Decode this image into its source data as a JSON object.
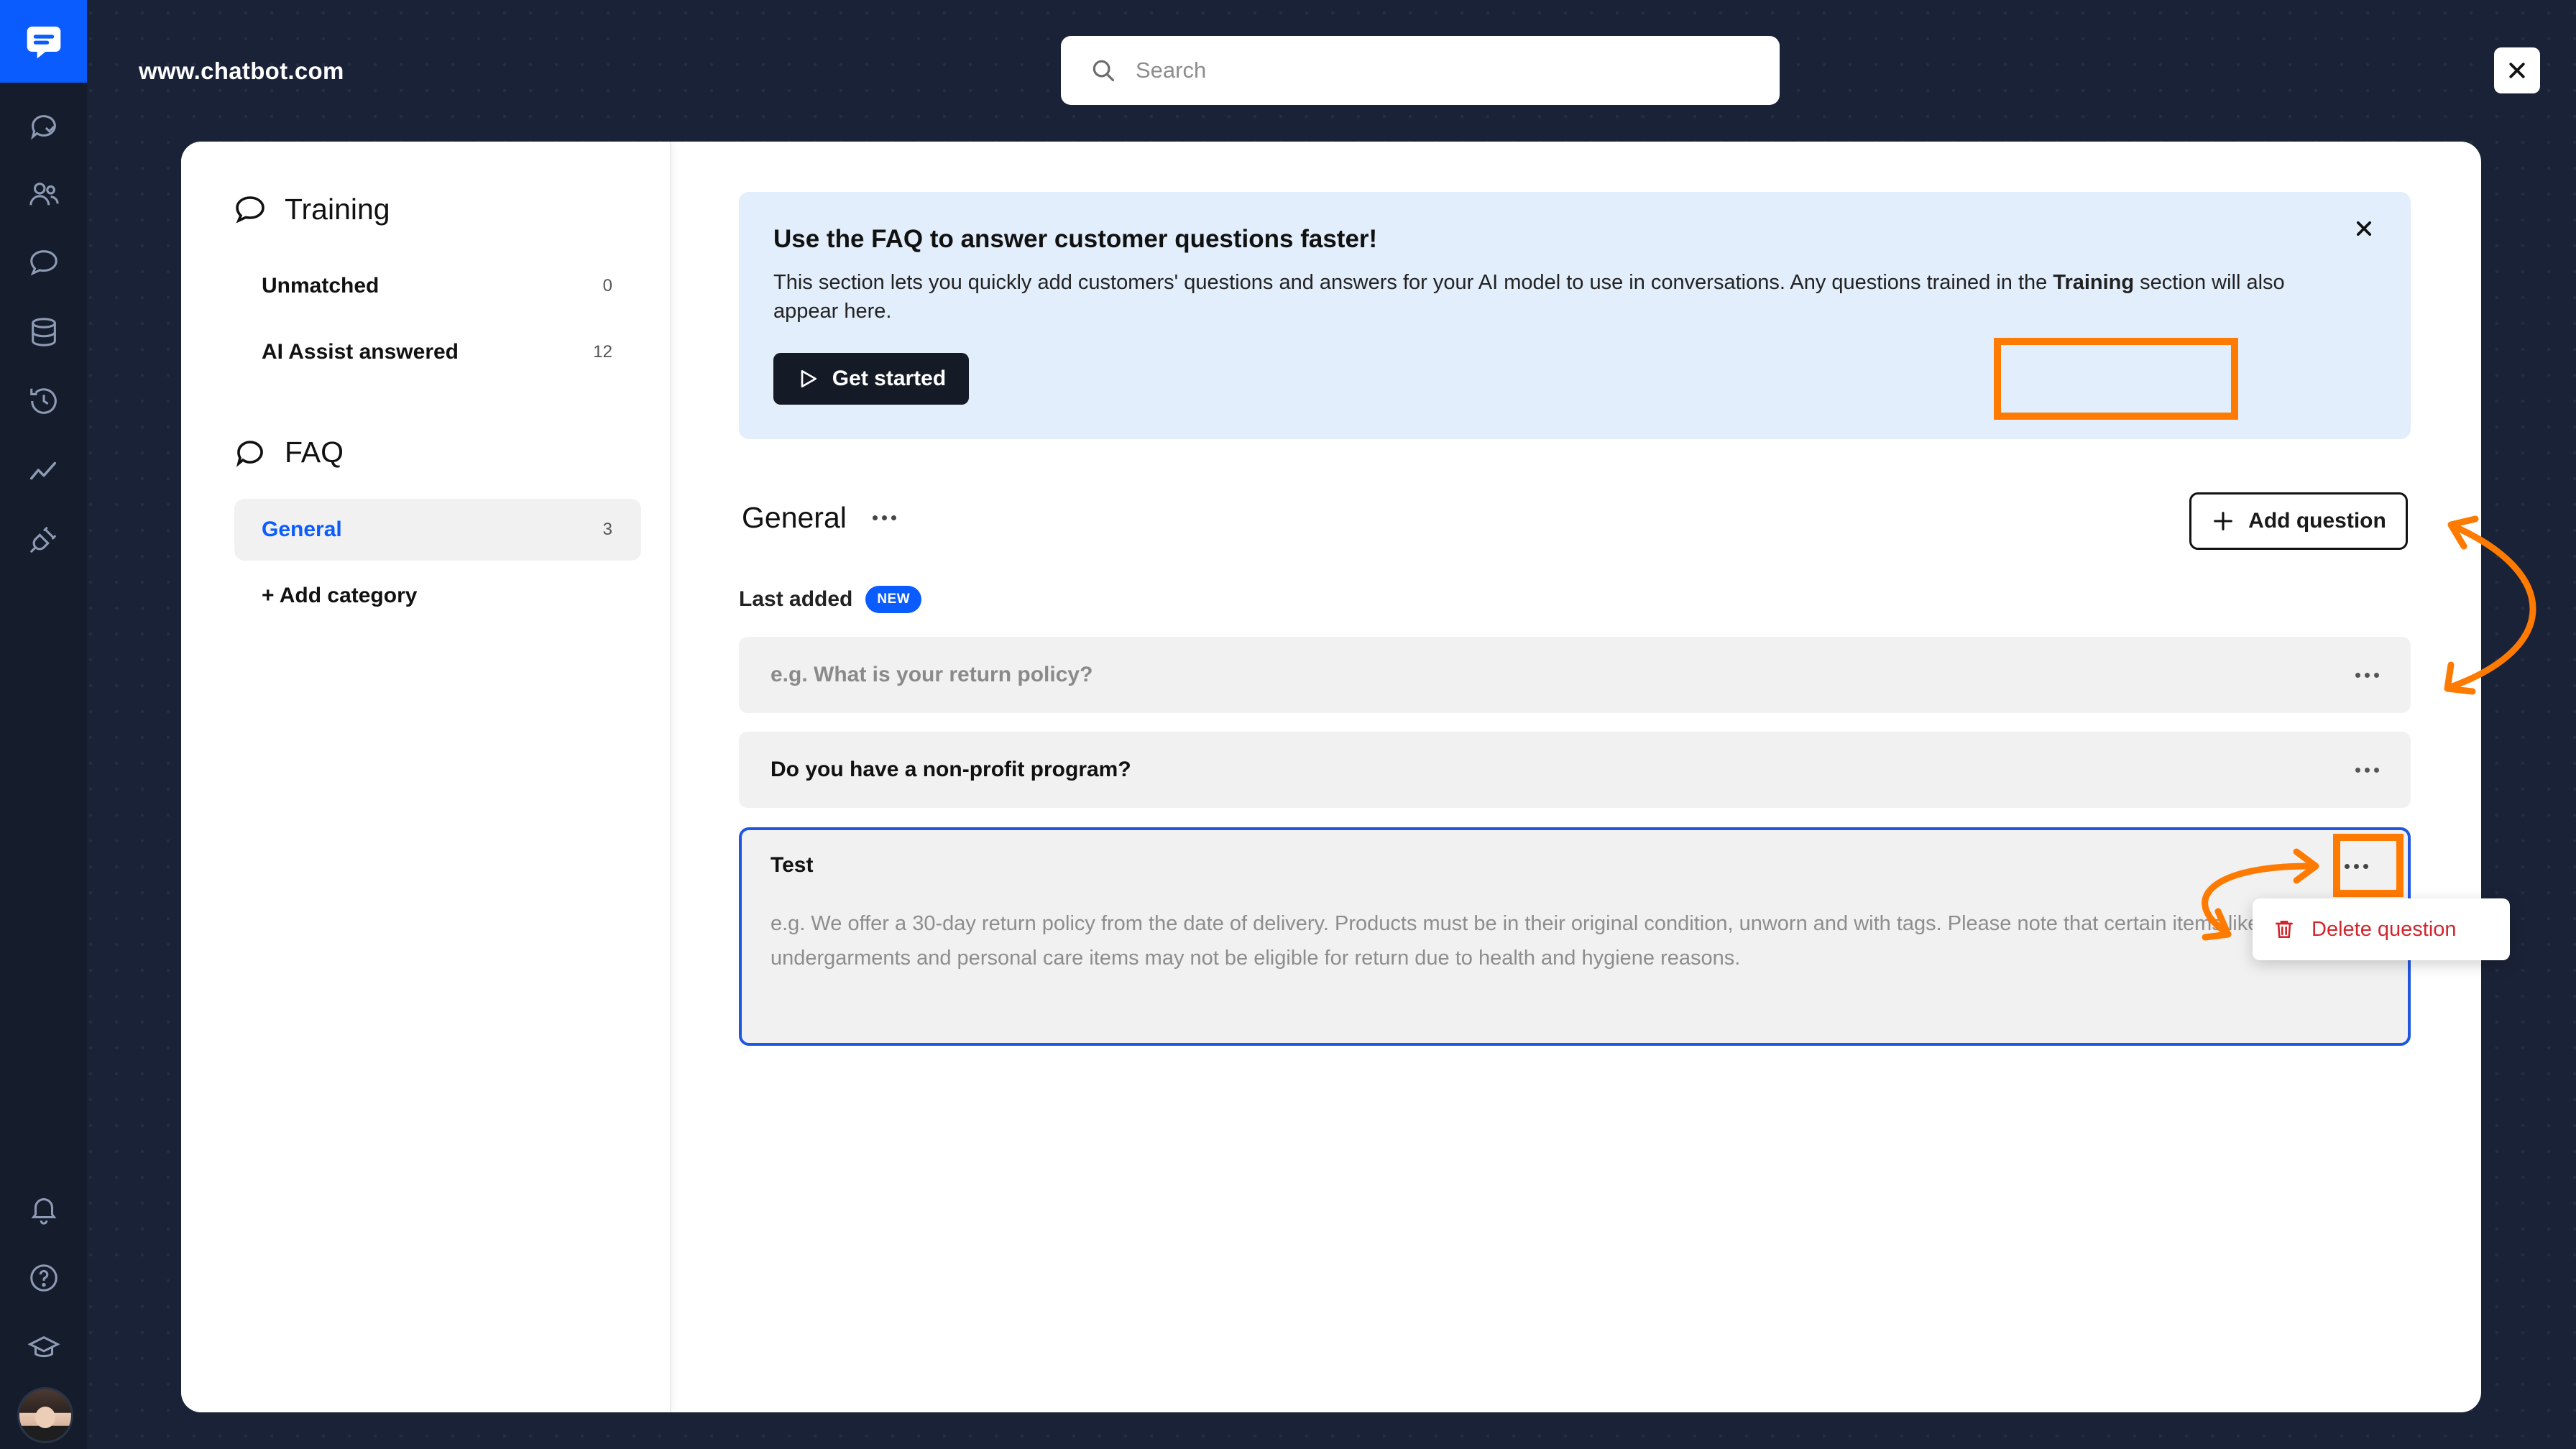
{
  "site": {
    "title": "www.chatbot.com"
  },
  "search": {
    "placeholder": "Search"
  },
  "sidebar": {
    "training_heading": "Training",
    "training_items": [
      {
        "label": "Unmatched",
        "count": "0"
      },
      {
        "label": "AI Assist answered",
        "count": "12"
      }
    ],
    "faq_heading": "FAQ",
    "faq_items": [
      {
        "label": "General",
        "count": "3",
        "active": true
      }
    ],
    "add_category": "+ Add category"
  },
  "banner": {
    "title": "Use the FAQ to answer customer questions faster!",
    "body_before": "This section lets you quickly add customers' questions and answers for your AI model to use in conversations. Any questions trained in the ",
    "body_bold": "Training",
    "body_after": " section will also appear here.",
    "button": "Get started"
  },
  "category": {
    "title": "General",
    "add_button": "Add question",
    "last_added": "Last added",
    "badge": "NEW",
    "questions": [
      {
        "text": "e.g. What is your return policy?",
        "is_placeholder": true
      },
      {
        "text": "Do you have a non-profit program?",
        "is_placeholder": false
      }
    ],
    "editing": {
      "question": "Test",
      "answer_placeholder": "e.g. We offer a 30-day return policy from the date of delivery. Products must be in their original condition, unworn and with tags. Please note that certain items like undergarments and personal care items may not be eligible for return due to health and hygiene reasons."
    }
  },
  "context_menu": {
    "delete": "Delete question"
  },
  "colors": {
    "accent": "#0b5cff",
    "highlight": "#ff7a00",
    "background": "#1a2237",
    "danger": "#d0262d"
  },
  "icons": [
    "chat-logo-icon",
    "chats-icon",
    "customers-icon",
    "training-icon",
    "database-icon",
    "history-icon",
    "reports-icon",
    "integrations-icon",
    "bell-icon",
    "help-icon",
    "academy-icon",
    "search-icon",
    "close-icon",
    "play-icon",
    "plus-icon",
    "trash-icon"
  ]
}
